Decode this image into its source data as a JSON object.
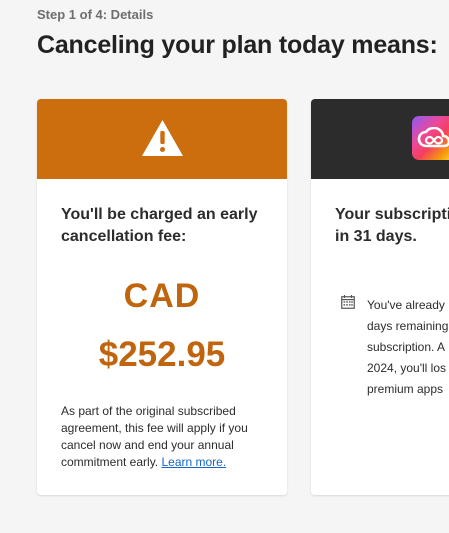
{
  "step": "Step 1 of 4: Details",
  "headline": "Canceling your plan today means:",
  "fee_card": {
    "title": "You'll be charged an early cancellation fee:",
    "currency": "CAD",
    "amount": "$252.95",
    "note": "As part of the original subscribed agreement, this fee will apply if you cancel now and end your annual commitment early.",
    "link": "Learn more."
  },
  "subscription_card": {
    "title_lines": [
      "Your subscriptic",
      "in 31 days."
    ],
    "info_lines": [
      "You've already",
      "days remaining",
      "subscription. A",
      "2024, you'll los",
      "premium apps"
    ]
  },
  "colors": {
    "warning_orange": "#cc6d0e",
    "fee_text": "#c0650d",
    "dark_header": "#2c2c2c",
    "link": "#1466c7"
  },
  "icons": {
    "warning": "warning-triangle-icon",
    "app": "creative-cloud-icon",
    "calendar": "calendar-icon"
  }
}
